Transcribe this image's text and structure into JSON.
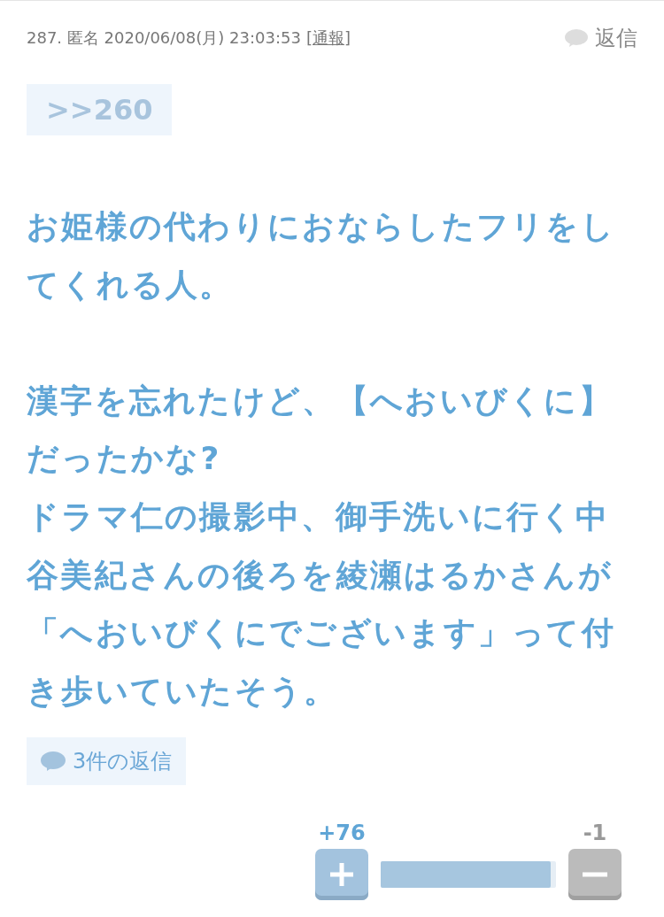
{
  "comment": {
    "number": "287.",
    "author": "匿名",
    "date": "2020/06/08(月) 23:03:53",
    "report_link": "[通報]",
    "reply_button": "返信",
    "anchor": ">>260",
    "body_paragraphs": [
      [
        "お姫様の代わりにおならしたフリをし",
        "てくれる人。"
      ],
      [
        "漢字を忘れたけど、【へおいびくに】",
        "だったかな?",
        "ドラマ仁の撮影中、御手洗いに行く中",
        "谷美紀さんの後ろを綾瀬はるかさんが",
        "「へおいびくにでございます」って付",
        "き歩いていたそう。"
      ]
    ],
    "replies_button": "3件の返信",
    "votes": {
      "plus": "+76",
      "minus": "-1",
      "level": 0.97
    }
  }
}
